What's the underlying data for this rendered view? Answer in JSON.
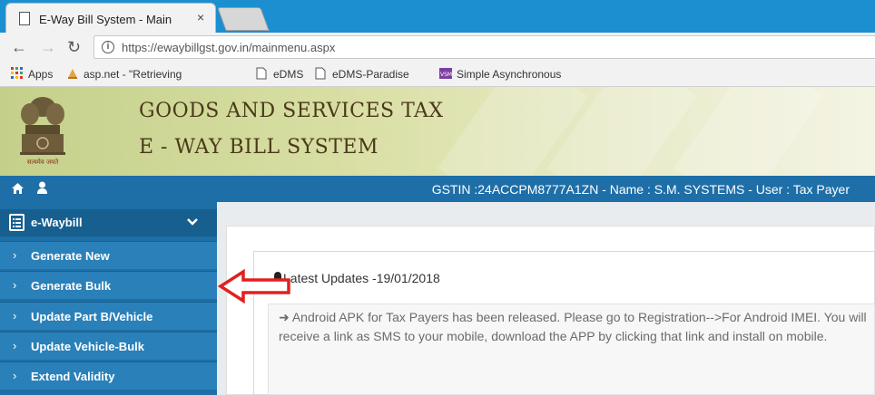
{
  "browser": {
    "tab_title": "E-Way Bill System - Main",
    "tab_close": "×",
    "url": "https://ewaybillgst.gov.in/mainmenu.aspx",
    "info_glyph": "i",
    "bookmarks": [
      {
        "label": "Apps",
        "icon": "apps-grid-icon"
      },
      {
        "label": "asp.net - \"Retrieving",
        "icon": "aspnet-icon"
      },
      {
        "label": "eDMS",
        "icon": "page-icon"
      },
      {
        "label": "eDMS-Paradise",
        "icon": "page-icon"
      },
      {
        "label": "Simple Asynchronous",
        "icon": "vsm-icon"
      }
    ]
  },
  "banner": {
    "line1": "GOODS AND SERVICES TAX",
    "line2": "E - WAY BILL SYSTEM",
    "emblem_caption": "सत्यमेव जयते"
  },
  "topnav": {
    "gstin_text": "GSTIN :24ACCPM8777A1ZN - Name : S.M. SYSTEMS - User : Tax Payer"
  },
  "sidebar": {
    "header": "e-Waybill",
    "items": [
      {
        "label": "Generate New"
      },
      {
        "label": "Generate Bulk"
      },
      {
        "label": "Update Part B/Vehicle"
      },
      {
        "label": "Update Vehicle-Bulk"
      },
      {
        "label": "Extend Validity"
      }
    ]
  },
  "main": {
    "updates_title": "Latest Updates -19/01/2018",
    "news": "➜ Android APK for Tax Payers has been released. Please go to Registration-->For Android IMEI. You will receive a link as SMS to your mobile, download the APP by clicking that link and install on mobile."
  },
  "colors": {
    "nav_blue": "#1e6fa8",
    "sidebar_blue": "#2a80b9",
    "annotation_red": "#e02020"
  }
}
